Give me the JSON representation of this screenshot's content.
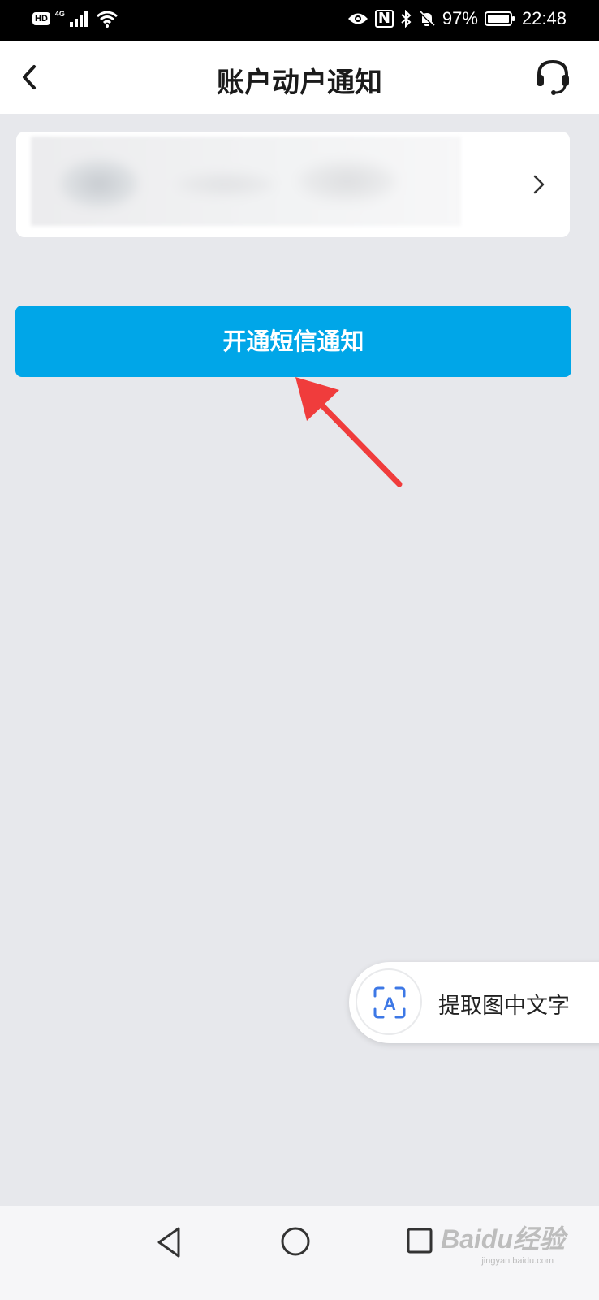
{
  "status_bar": {
    "hd": "HD",
    "network": "4G",
    "battery_percent": "97%",
    "time": "22:48",
    "icons": [
      "signal-icon",
      "wifi-icon",
      "eye-icon",
      "nfc-icon",
      "bluetooth-icon",
      "mute-bell-icon",
      "battery-icon"
    ]
  },
  "header": {
    "title": "账户动户通知",
    "back_icon": "chevron-left-icon",
    "service_icon": "headset-icon"
  },
  "account_card": {
    "chevron_icon": "chevron-right-icon"
  },
  "primary_button": {
    "label": "开通短信通知",
    "color": "#00a6e8"
  },
  "annotation": {
    "arrow_color": "#f03c3c"
  },
  "ocr_pill": {
    "label": "提取图中文字",
    "icon_letter": "A",
    "icon_color": "#3d78e6"
  },
  "nav_bar": {
    "icons": [
      "triangle-back-icon",
      "circle-home-icon",
      "square-recent-icon"
    ]
  },
  "watermark": {
    "text": "Baidu经验",
    "subtext": "jingyan.baidu.com"
  },
  "colors": {
    "background": "#e7e8ec",
    "header_bg": "#ffffff",
    "text_dark": "#1b1b1b"
  }
}
